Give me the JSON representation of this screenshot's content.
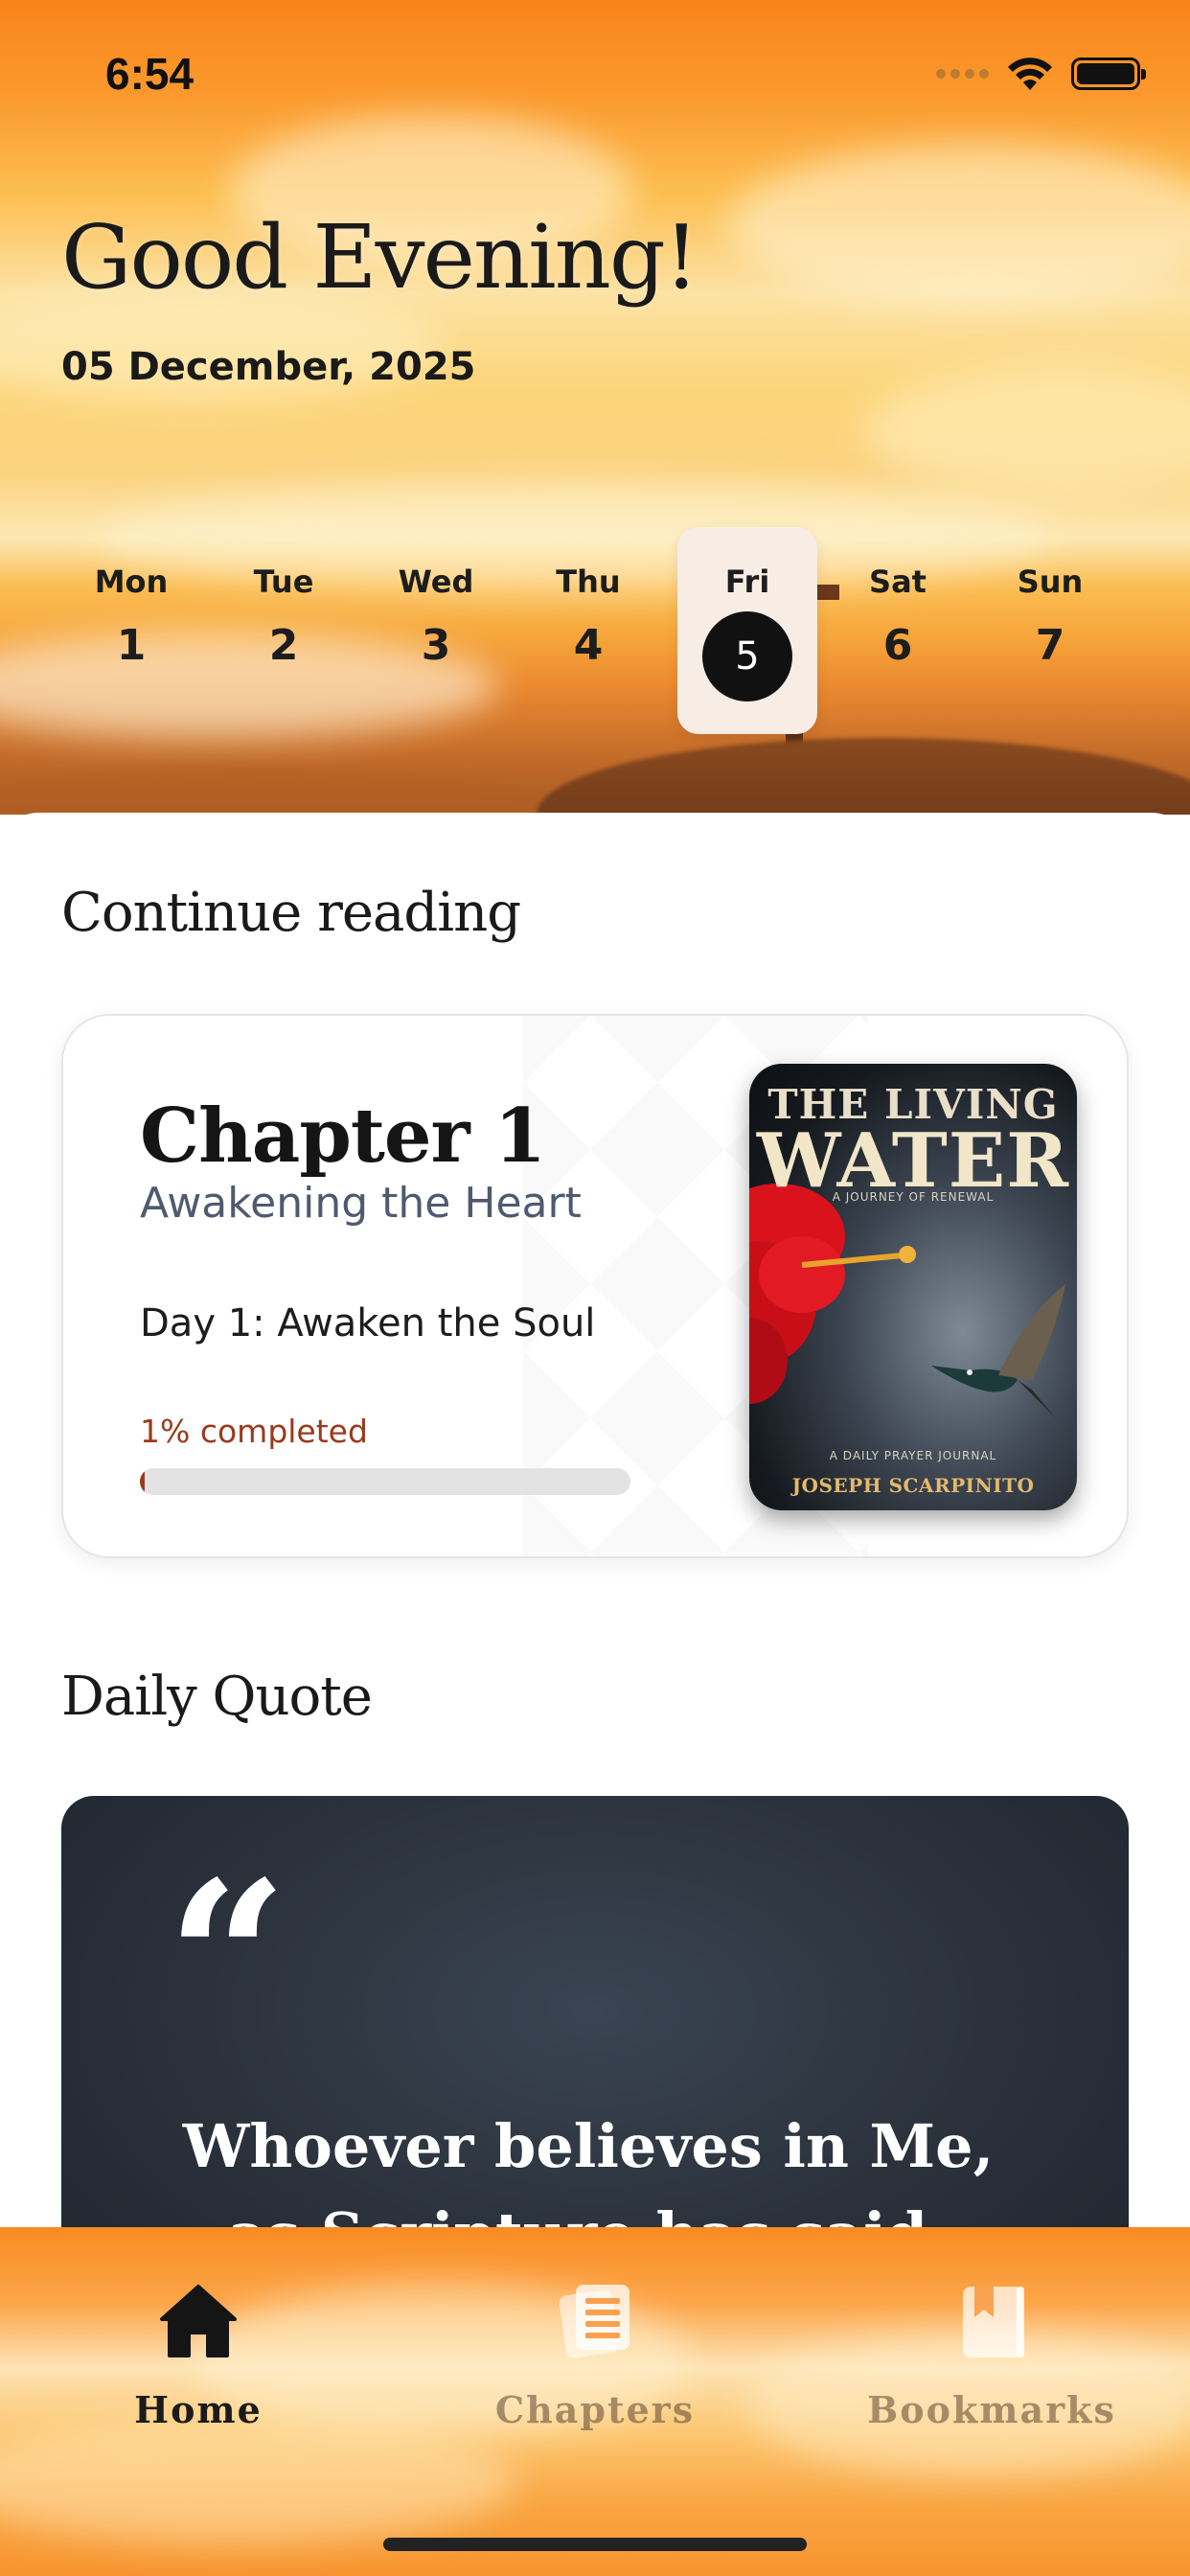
{
  "status_bar": {
    "time": "6:54"
  },
  "header": {
    "greeting": "Good Evening!",
    "date": "05 December, 2025"
  },
  "week": [
    {
      "day": "Mon",
      "num": "1",
      "selected": false
    },
    {
      "day": "Tue",
      "num": "2",
      "selected": false
    },
    {
      "day": "Wed",
      "num": "3",
      "selected": false
    },
    {
      "day": "Thu",
      "num": "4",
      "selected": false
    },
    {
      "day": "Fri",
      "num": "5",
      "selected": true
    },
    {
      "day": "Sat",
      "num": "6",
      "selected": false
    },
    {
      "day": "Sun",
      "num": "7",
      "selected": false
    }
  ],
  "continue_reading": {
    "section_title": "Continue reading",
    "chapter": "Chapter 1",
    "subtitle": "Awakening the Heart",
    "day_title": "Day 1: Awaken the Soul",
    "progress_label": "1% completed",
    "progress_percent": 1,
    "book": {
      "title_line1": "THE LIVING",
      "title_line2": "WATER",
      "tagline": "A JOURNEY OF RENEWAL",
      "tagline2": "A DAILY PRAYER JOURNAL",
      "author": "JOSEPH SCARPINITO"
    }
  },
  "daily_quote": {
    "section_title": "Daily Quote",
    "quote_mark": "“",
    "text": "Whoever believes in Me, as Scripture has said, rivers of"
  },
  "tabs": [
    {
      "label": "Home",
      "icon": "home-icon",
      "active": true
    },
    {
      "label": "Chapters",
      "icon": "chapters-icon",
      "active": false
    },
    {
      "label": "Bookmarks",
      "icon": "bookmarks-icon",
      "active": false
    }
  ],
  "colors": {
    "accent_progress": "#9a3a1c",
    "subtitle": "#4f5a70",
    "header_orange": "#f8841a"
  }
}
